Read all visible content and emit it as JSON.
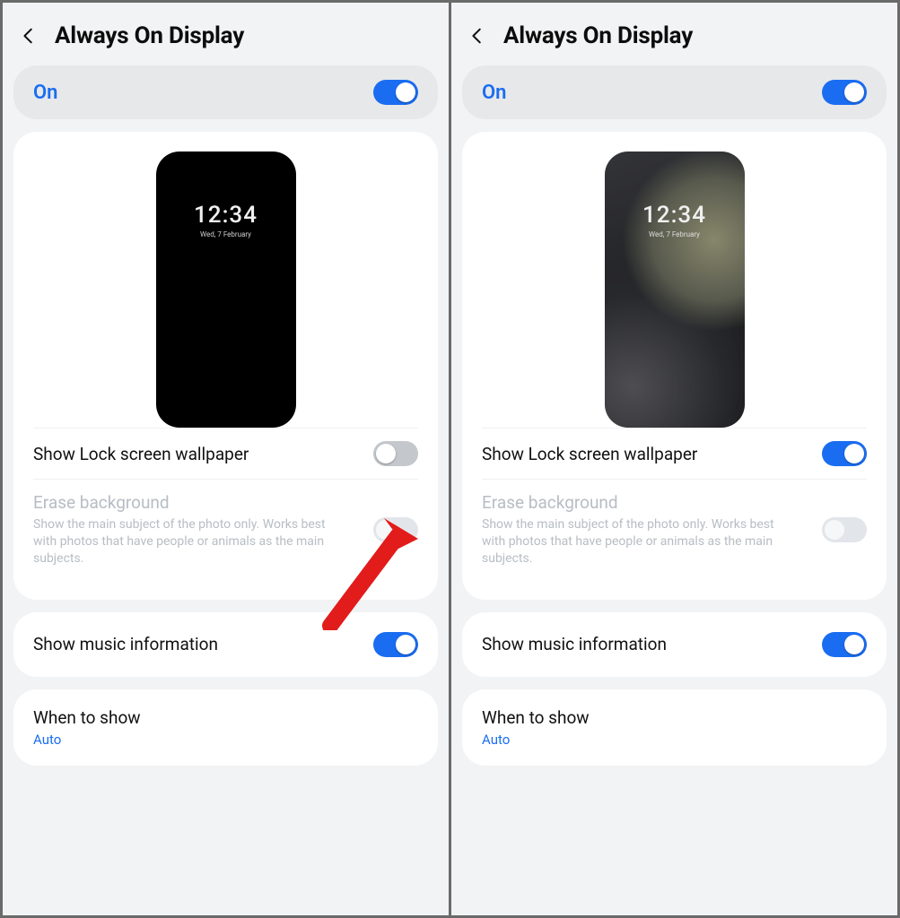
{
  "left": {
    "title": "Always On Display",
    "master_label": "On",
    "master_on": true,
    "preview": {
      "time": "12:34",
      "date": "Wed, 7 February",
      "wallpaper": false
    },
    "show_wallpaper": {
      "label": "Show Lock screen wallpaper",
      "on": false
    },
    "erase_bg": {
      "label": "Erase background",
      "sub": "Show the main subject of the photo only. Works best with photos that have people or animals as the main subjects.",
      "on": false,
      "disabled": true
    },
    "music": {
      "label": "Show music information",
      "on": true
    },
    "when": {
      "label": "When to show",
      "value": "Auto"
    }
  },
  "right": {
    "title": "Always On Display",
    "master_label": "On",
    "master_on": true,
    "preview": {
      "time": "12:34",
      "date": "Wed, 7 February",
      "wallpaper": true
    },
    "show_wallpaper": {
      "label": "Show Lock screen wallpaper",
      "on": true
    },
    "erase_bg": {
      "label": "Erase background",
      "sub": "Show the main subject of the photo only. Works best with photos that have people or animals as the main subjects.",
      "on": false,
      "disabled": true
    },
    "music": {
      "label": "Show music information",
      "on": true
    },
    "when": {
      "label": "When to show",
      "value": "Auto"
    }
  }
}
